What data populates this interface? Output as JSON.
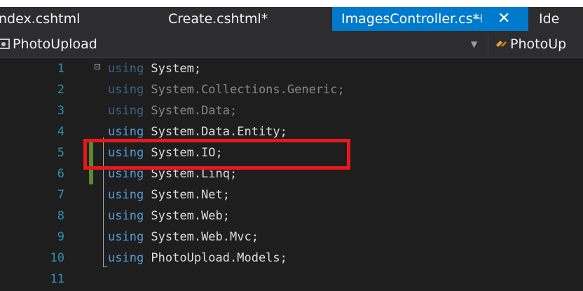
{
  "tabs": [
    {
      "label": "ndex.cshtml"
    },
    {
      "label": "Create.cshtml*"
    },
    {
      "label": "ImagesController.cs*",
      "active": true
    },
    {
      "label": "Ide"
    }
  ],
  "tab_icons": {
    "pin": "pin-icon",
    "close": "close-icon"
  },
  "navbar": {
    "project": "PhotoUpload",
    "class_partial": "PhotoUp"
  },
  "code_lines": [
    {
      "number": "1",
      "keyword": "using",
      "text": " System;"
    },
    {
      "number": "2",
      "keyword": "using",
      "text": " System.Collections.Generic;"
    },
    {
      "number": "3",
      "keyword": "using",
      "text": " System.Data;"
    },
    {
      "number": "4",
      "keyword": "using",
      "text": " System.Data.Entity;"
    },
    {
      "number": "5",
      "keyword": "using",
      "text": " System.IO;"
    },
    {
      "number": "6",
      "keyword": "using",
      "text": " System.Linq;"
    },
    {
      "number": "7",
      "keyword": "using",
      "text": " System.Net;"
    },
    {
      "number": "8",
      "keyword": "using",
      "text": " System.Web;"
    },
    {
      "number": "9",
      "keyword": "using",
      "text": " System.Web.Mvc;"
    },
    {
      "number": "10",
      "keyword": "using",
      "text": " PhotoUpload.Models;"
    },
    {
      "number": "11",
      "keyword": "",
      "text": ""
    }
  ],
  "colors": {
    "keyword": "#569cd6",
    "line_number": "#2b91af",
    "active_tab": "#007acc",
    "highlight_box": "#e8171b",
    "change_marker": "#5b8a2e"
  }
}
